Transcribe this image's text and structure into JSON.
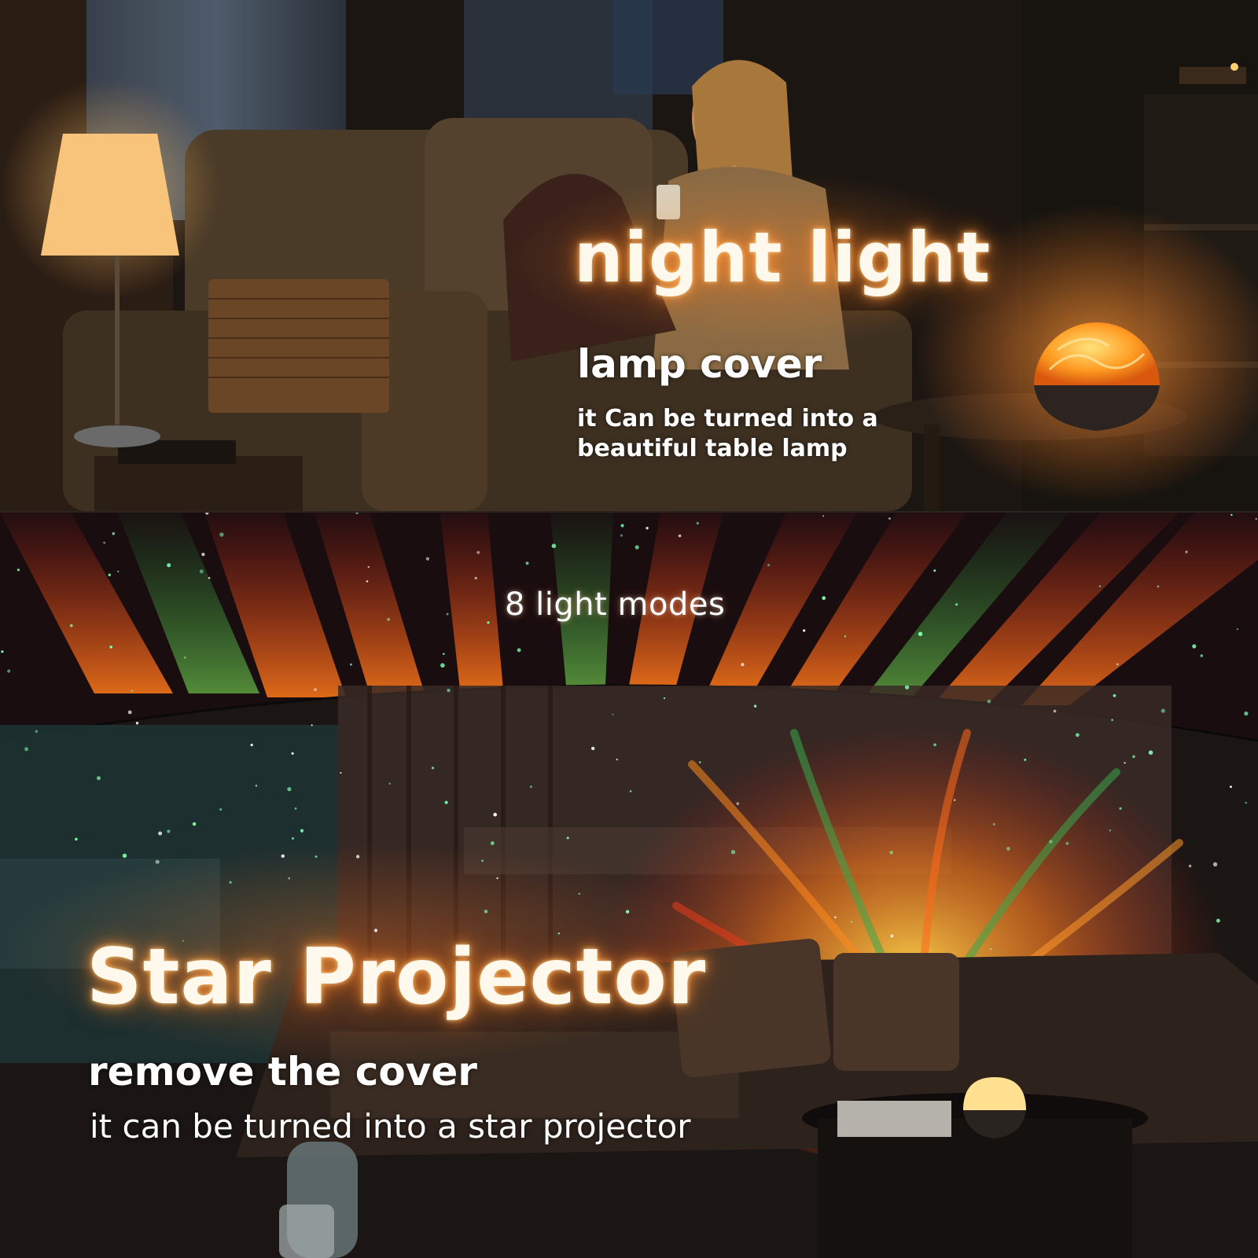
{
  "night_light": {
    "title": "night light",
    "heading": "lamp cover",
    "description": "it Can be turned into a beautiful table lamp"
  },
  "star_projector": {
    "modes": "8 light modes",
    "title": "Star Projector",
    "heading": "remove the cover",
    "description": "it can be turned into a star projector"
  },
  "colors": {
    "glow": "#ffb25a",
    "aurora_red": "#e0301c",
    "aurora_orange": "#ff8a1e",
    "aurora_green": "#2faa4a"
  }
}
